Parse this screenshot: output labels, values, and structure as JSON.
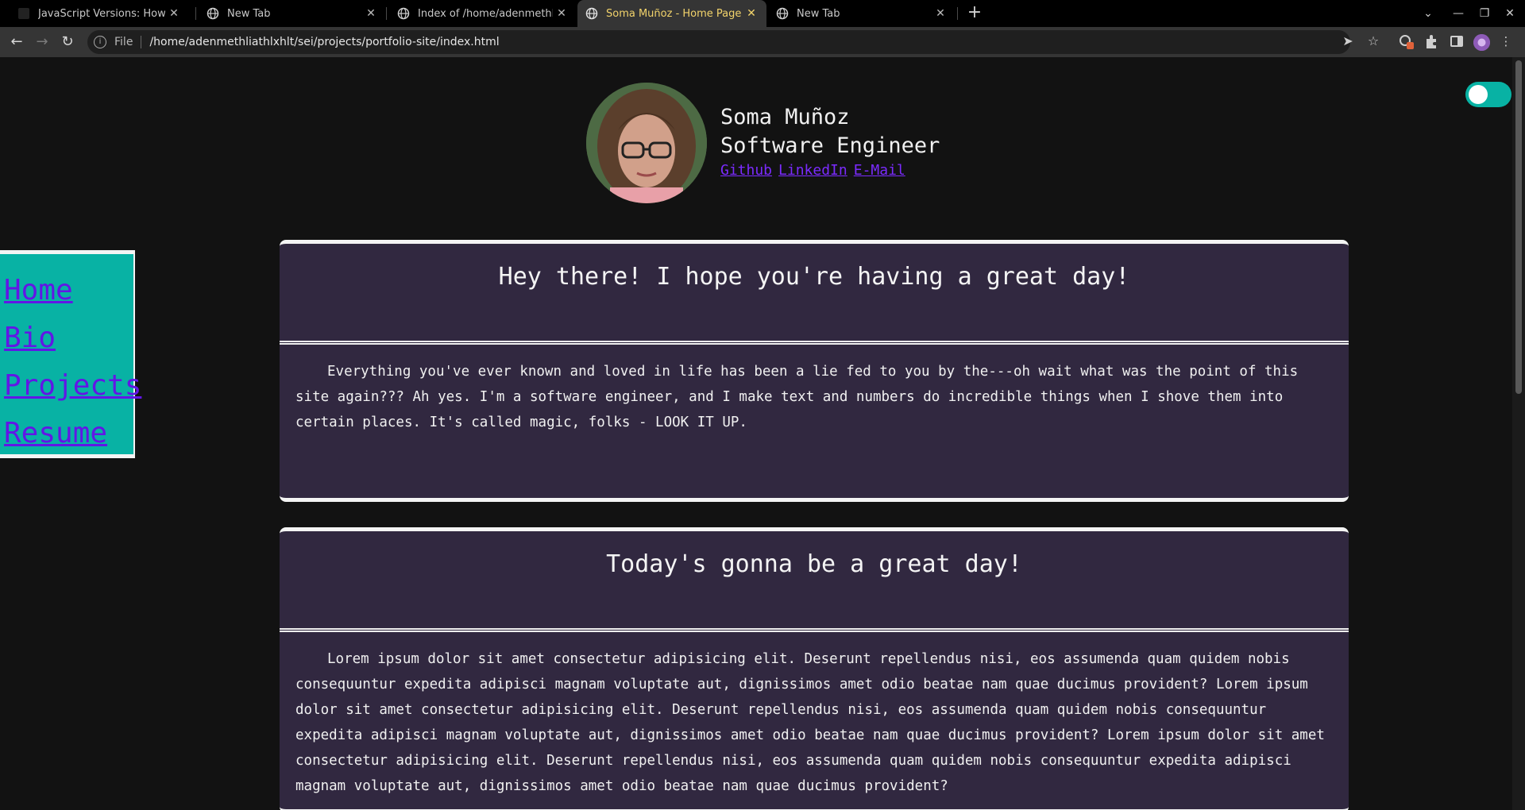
{
  "browser": {
    "tabs": [
      {
        "title": "JavaScript Versions: How JavaS",
        "active": false
      },
      {
        "title": "New Tab",
        "active": false
      },
      {
        "title": "Index of /home/adenmethliathlxhlt",
        "active": false
      },
      {
        "title": "Soma Muñoz - Home Page",
        "active": true
      },
      {
        "title": "New Tab",
        "active": false
      }
    ],
    "new_tab_label": "+",
    "address": {
      "scheme": "File",
      "url": "/home/adenmethliathlxhlt/sei/projects/portfolio-site/index.html"
    }
  },
  "header": {
    "name": "Soma Muñoz",
    "role": "Software Engineer",
    "links": [
      "Github",
      "LinkedIn",
      "E-Mail"
    ]
  },
  "nav": {
    "items": [
      "Home",
      "Bio",
      "Projects",
      "Resume"
    ]
  },
  "cards": [
    {
      "title": "Hey there! I hope you're having a great day!",
      "body": "Everything you've ever known and loved in life has been a lie fed to you by the---oh wait what was the point of this site again??? Ah yes. I'm a software engineer, and I make text and numbers do incredible things when I shove them into certain places. It's called magic, folks - LOOK IT UP."
    },
    {
      "title": "Today's gonna be a great day!",
      "body": "Lorem ipsum dolor sit amet consectetur adipisicing elit. Deserunt repellendus nisi, eos assumenda quam quidem nobis consequuntur expedita adipisci magnam voluptate aut, dignissimos amet odio beatae nam quae ducimus provident? Lorem ipsum dolor sit amet consectetur adipisicing elit. Deserunt repellendus nisi, eos assumenda quam quidem nobis consequuntur expedita adipisci magnam voluptate aut, dignissimos amet odio beatae nam quae ducimus provident? Lorem ipsum dolor sit amet consectetur adipisicing elit. Deserunt repellendus nisi, eos assumenda quam quidem nobis consequuntur expedita adipisci magnam voluptate aut, dignissimos amet odio beatae nam quae ducimus provident?"
    }
  ],
  "theme_toggle": {
    "on": true
  },
  "colors": {
    "accent_teal": "#08b2a4",
    "card_bg": "#312840",
    "link_purple": "#6216e6",
    "active_tab_text": "#f2d36b"
  },
  "icons": {
    "back": "arrow-left-icon",
    "forward": "arrow-right-icon",
    "reload": "reload-icon",
    "site_info": "info-icon",
    "send": "send-icon",
    "bookmark": "star-icon",
    "extensions": "puzzle-icon",
    "sidebar": "side-panel-icon",
    "menu": "kebab-menu-icon"
  }
}
